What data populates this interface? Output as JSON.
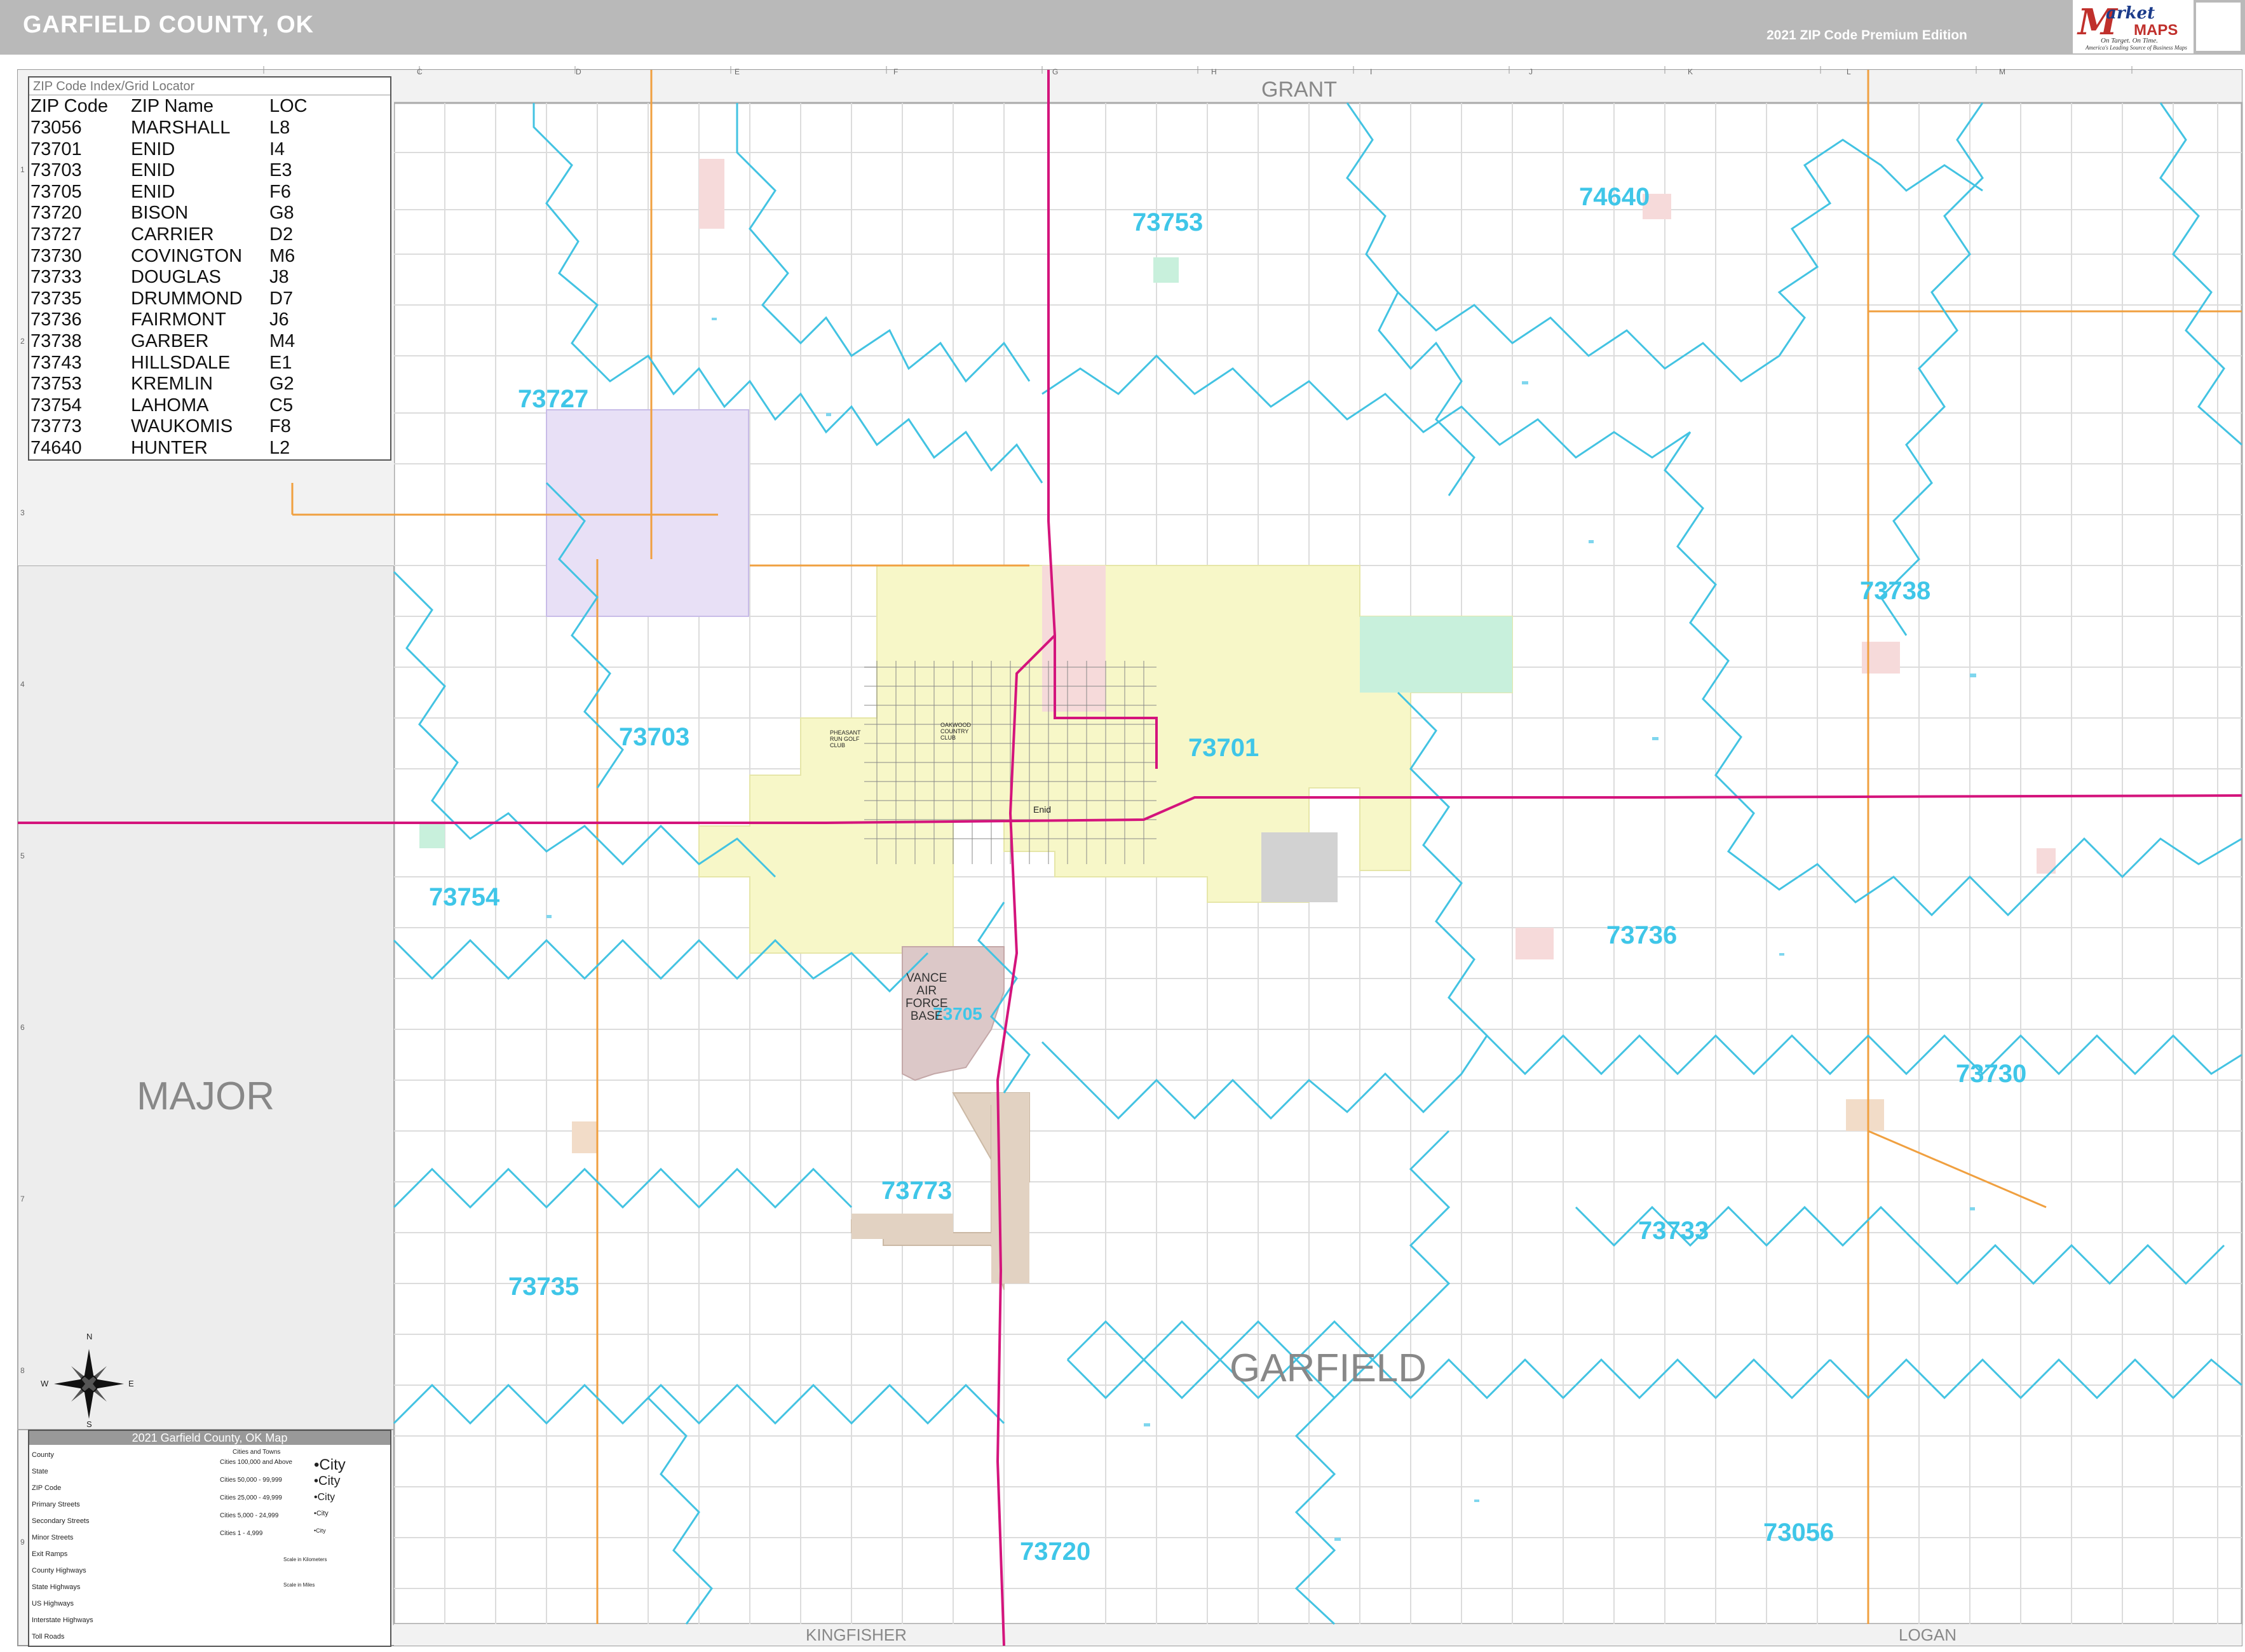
{
  "header": {
    "title": "GARFIELD COUNTY, OK",
    "edition": "2021 ZIP Code Premium Edition",
    "logo_m": "M",
    "logo_arket": "arket",
    "logo_maps": "MAPS",
    "logo_tagline": "On Target. On Time.",
    "logo_tagline2": "America's Leading Source of Business Maps"
  },
  "index": {
    "title": "ZIP Code Index/Grid Locator",
    "headers": {
      "zip": "ZIP Code",
      "name": "ZIP Name",
      "loc": "LOC"
    },
    "rows": [
      {
        "zip": "73056",
        "name": "MARSHALL",
        "loc": "L8"
      },
      {
        "zip": "73701",
        "name": "ENID",
        "loc": "I4"
      },
      {
        "zip": "73703",
        "name": "ENID",
        "loc": "E3"
      },
      {
        "zip": "73705",
        "name": "ENID",
        "loc": "F6"
      },
      {
        "zip": "73720",
        "name": "BISON",
        "loc": "G8"
      },
      {
        "zip": "73727",
        "name": "CARRIER",
        "loc": "D2"
      },
      {
        "zip": "73730",
        "name": "COVINGTON",
        "loc": "M6"
      },
      {
        "zip": "73733",
        "name": "DOUGLAS",
        "loc": "J8"
      },
      {
        "zip": "73735",
        "name": "DRUMMOND",
        "loc": "D7"
      },
      {
        "zip": "73736",
        "name": "FAIRMONT",
        "loc": "J6"
      },
      {
        "zip": "73738",
        "name": "GARBER",
        "loc": "M4"
      },
      {
        "zip": "73743",
        "name": "HILLSDALE",
        "loc": "E1"
      },
      {
        "zip": "73753",
        "name": "KREMLIN",
        "loc": "G2"
      },
      {
        "zip": "73754",
        "name": "LAHOMA",
        "loc": "C5"
      },
      {
        "zip": "73773",
        "name": "WAUKOMIS",
        "loc": "F8"
      },
      {
        "zip": "74640",
        "name": "HUNTER",
        "loc": "L2"
      }
    ]
  },
  "zip_labels": {
    "z73753": "73753",
    "z74640": "74640",
    "z73727": "73727",
    "z73738": "73738",
    "z73703": "73703",
    "z73701": "73701",
    "z73754": "73754",
    "z73736": "73736",
    "z73705": "73705",
    "z73730": "73730",
    "z73773": "73773",
    "z73733": "73733",
    "z73735": "73735",
    "z73056": "73056",
    "z73720": "73720"
  },
  "county_labels": {
    "grant": "GRANT",
    "major": "MAJOR",
    "garfield": "GARFIELD",
    "kingfisher": "KINGFISHER",
    "logan": "LOGAN"
  },
  "places": {
    "vance_air_force_base": "VANCE\nAIR\nFORCE\nBASE",
    "enid": "Enid",
    "oakwood_country_club": "OAKWOOD\nCOUNTRY\nCLUB",
    "pheasant_run_golf_club": "PHEASANT\nRUN GOLF\nCLUB"
  },
  "grid": {
    "columns": [
      "C",
      "D",
      "E",
      "F",
      "G",
      "H",
      "I",
      "J",
      "K",
      "L",
      "M"
    ],
    "rows": [
      "1",
      "2",
      "3",
      "4",
      "5",
      "6",
      "7",
      "8",
      "9"
    ]
  },
  "compass": {
    "n": "N",
    "s": "S",
    "e": "E",
    "w": "W"
  },
  "legend": {
    "title": "2021 Garfield County, OK Map",
    "items": [
      "County",
      "State",
      "ZIP Code",
      "Primary Streets",
      "Secondary Streets",
      "Minor Streets",
      "Exit Ramps",
      "County Highways",
      "State Highways",
      "US Highways",
      "Interstate Highways",
      "Toll Roads"
    ],
    "city_header": "Cities and Towns",
    "city_items": [
      "Cities 100,000 and Above",
      "Cities 50,000 - 99,999",
      "Cities 25,000 - 49,999",
      "Cities 5,000 - 24,999",
      "Cities 1 - 4,999"
    ],
    "city_samples": [
      "•City",
      "•City",
      "•City",
      "•City",
      "•City"
    ],
    "scale_km": "Scale in Kilometers",
    "scale_mi": "Scale in Miles"
  },
  "colors": {
    "zip_line": "#43c3e2",
    "zip_label": "#3fc6e8",
    "us_highway": "#d4147c",
    "state_highway": "#f0a040",
    "county_border": "#999999",
    "enid_fill": "#f7f7c8",
    "carrier_fill": "#e8e0f6",
    "vance_fill": "#dcc8c8",
    "waukomis_fill": "#e2d2c2",
    "kremlin_fill": "#c8f0dc"
  }
}
